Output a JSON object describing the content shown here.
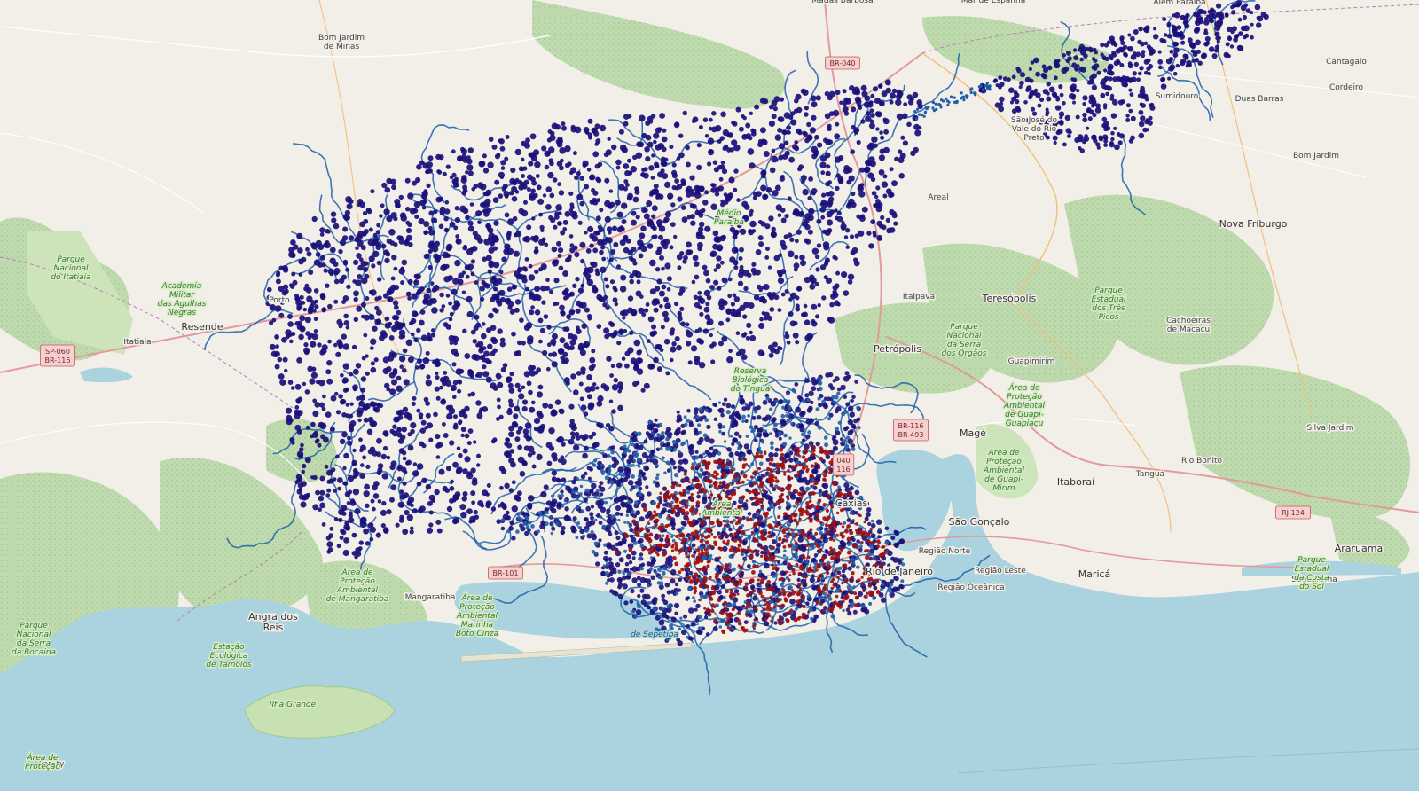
{
  "map": {
    "colors": {
      "land": "#f2efe9",
      "park": "#cfe3b4",
      "forest": "#add19e",
      "water": "#aad3df",
      "road_major": "#e7a4a4",
      "road_minor": "#ffffff",
      "points_dark": "#1a0f7a",
      "points_mid": "#1f5fa8",
      "points_red": "#a30d0d"
    },
    "places": [
      {
        "label": "Bom Jardim\nde Minas",
        "kind": "town"
      },
      {
        "label": "Parque\nNacional\ndo Itatiaia",
        "kind": "park"
      },
      {
        "label": "Academia\nMilitar\ndas Agulhas\nNegras",
        "kind": "park"
      },
      {
        "label": "Resende",
        "kind": "city"
      },
      {
        "label": "Itatiaia",
        "kind": "town"
      },
      {
        "label": "Porto",
        "kind": "town"
      },
      {
        "label": "Areal",
        "kind": "town"
      },
      {
        "label": "Itaipava",
        "kind": "town"
      },
      {
        "label": "Petrópolis",
        "kind": "city"
      },
      {
        "label": "Teresópolis",
        "kind": "city"
      },
      {
        "label": "Nova Friburgo",
        "kind": "city"
      },
      {
        "label": "Sumidouro",
        "kind": "town"
      },
      {
        "label": "Duas Barras",
        "kind": "town"
      },
      {
        "label": "Cantagalo",
        "kind": "town"
      },
      {
        "label": "Cordeiro",
        "kind": "town"
      },
      {
        "label": "Bom Jardim",
        "kind": "town"
      },
      {
        "label": "São José do\nVale do Rio\nPreto",
        "kind": "town"
      },
      {
        "label": "Parque\nNacional\nda Serra\ndos Órgãos",
        "kind": "park"
      },
      {
        "label": "Parque\nEstadual\ndos Três\nPicos",
        "kind": "park"
      },
      {
        "label": "Cachoeiras\nde Macacu",
        "kind": "town"
      },
      {
        "label": "Guapimirim",
        "kind": "town"
      },
      {
        "label": "Área de\nProteção\nAmbiental\nde Guapi-\nGuapiaçu",
        "kind": "park"
      },
      {
        "label": "Magé",
        "kind": "city"
      },
      {
        "label": "Área de\nProteção\nAmbiental\nde Guapi-\nMirim",
        "kind": "park"
      },
      {
        "label": "Itaboraí",
        "kind": "city"
      },
      {
        "label": "Tanguá",
        "kind": "town"
      },
      {
        "label": "Rio Bonito",
        "kind": "town"
      },
      {
        "label": "Silva Jardim",
        "kind": "town"
      },
      {
        "label": "São Gonçalo",
        "kind": "city"
      },
      {
        "label": "Região Norte",
        "kind": "town"
      },
      {
        "label": "Região Leste",
        "kind": "town"
      },
      {
        "label": "Região Oceânica",
        "kind": "town"
      },
      {
        "label": "Maricá",
        "kind": "city"
      },
      {
        "label": "Saquarema",
        "kind": "town"
      },
      {
        "label": "Araruama",
        "kind": "city"
      },
      {
        "label": "Parque\nEstadual\nda Costa\ndo Sol",
        "kind": "park"
      },
      {
        "label": "Reserva\nBiológica\ndo Tinguá",
        "kind": "park"
      },
      {
        "label": "Angra dos\nReis",
        "kind": "city"
      },
      {
        "label": "Mangaratiba",
        "kind": "town"
      },
      {
        "label": "Área de\nProteção\nAmbiental\nde Mangaratiba",
        "kind": "park"
      },
      {
        "label": "Área de\nProteção\nAmbiental\nMarinha\nBoto Cinza",
        "kind": "park"
      },
      {
        "label": "Estação\nEcológica\nde Tamoios",
        "kind": "park"
      },
      {
        "label": "Parque\nNacional\nda Serra\nda Bocaina",
        "kind": "park"
      },
      {
        "label": "Ilha Grande",
        "kind": "park"
      },
      {
        "label": "Paraty",
        "kind": "town"
      },
      {
        "label": "Área de\nProteção",
        "kind": "park"
      },
      {
        "label": "Além Paraíba",
        "kind": "town"
      },
      {
        "label": "Matias Barbosa",
        "kind": "town"
      },
      {
        "label": "Mar de Espanha",
        "kind": "town"
      },
      {
        "label": "Caxias",
        "kind": "city"
      },
      {
        "label": "Rio de Janeiro",
        "kind": "city"
      },
      {
        "label": "de Sepetiba",
        "kind": "water"
      },
      {
        "label": "Área\nAmbiental",
        "kind": "park"
      },
      {
        "label": "Médio\nParaíba",
        "kind": "park"
      }
    ],
    "shields": [
      "BR-040",
      "SP-060\nBR-116",
      "BR-116\nBR-493",
      "BR-101",
      "RJ-124",
      "040\n116"
    ]
  }
}
